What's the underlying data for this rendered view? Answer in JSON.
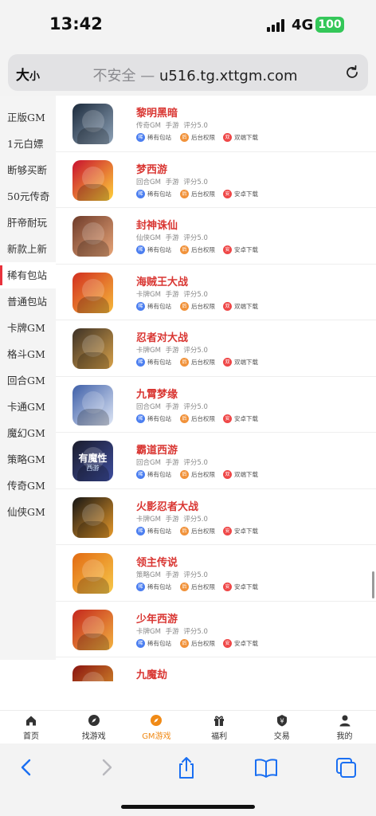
{
  "status_bar": {
    "time": "13:42",
    "network": "4G",
    "battery": "100"
  },
  "url_bar": {
    "text_size_label": "大",
    "text_size_small": "小",
    "insecure": "不安全 —",
    "domain": "u516.tg.xttgm.com"
  },
  "sidebar": {
    "items": [
      {
        "label": "正版GM",
        "active": false
      },
      {
        "label": "1元白嫖",
        "active": false
      },
      {
        "label": "断够买断",
        "active": false
      },
      {
        "label": "50元传奇",
        "active": false
      },
      {
        "label": "肝帝耐玩",
        "active": false
      },
      {
        "label": "新款上新",
        "active": false
      },
      {
        "label": "稀有包站",
        "active": true
      },
      {
        "label": "普通包站",
        "active": false
      },
      {
        "label": "卡牌GM",
        "active": false
      },
      {
        "label": "格斗GM",
        "active": false
      },
      {
        "label": "回合GM",
        "active": false
      },
      {
        "label": "卡通GM",
        "active": false
      },
      {
        "label": "魔幻GM",
        "active": false
      },
      {
        "label": "策略GM",
        "active": false
      },
      {
        "label": "传奇GM",
        "active": false
      },
      {
        "label": "仙侠GM",
        "active": false
      }
    ]
  },
  "games": [
    {
      "name": "黎明黑暗",
      "genre": "传奇GM",
      "platform": "手游",
      "rating": "评分5.0",
      "tag1": "稀有包站",
      "tag1_icon": "稀",
      "tag2": "后台权限",
      "tag2_icon": "后",
      "tag3": "双端下载",
      "tag3_icon": "双",
      "colors": [
        "#1b2a3c",
        "#8fa3b8"
      ]
    },
    {
      "name": "梦西游",
      "genre": "回合GM",
      "platform": "手游",
      "rating": "评分5.0",
      "tag1": "稀有包站",
      "tag1_icon": "稀",
      "tag2": "后台权限",
      "tag2_icon": "后",
      "tag3": "安卓下载",
      "tag3_icon": "安",
      "colors": [
        "#c8102e",
        "#ffd23a"
      ]
    },
    {
      "name": "封神诛仙",
      "genre": "仙侠GM",
      "platform": "手游",
      "rating": "评分5.0",
      "tag1": "稀有包站",
      "tag1_icon": "稀",
      "tag2": "后台权限",
      "tag2_icon": "后",
      "tag3": "安卓下载",
      "tag3_icon": "安",
      "colors": [
        "#6e3b2a",
        "#e8a578"
      ]
    },
    {
      "name": "海贼王大战",
      "genre": "卡牌GM",
      "platform": "手游",
      "rating": "评分5.0",
      "tag1": "稀有包站",
      "tag1_icon": "稀",
      "tag2": "后台权限",
      "tag2_icon": "后",
      "tag3": "双端下载",
      "tag3_icon": "双",
      "colors": [
        "#d22f1f",
        "#f6b93a"
      ]
    },
    {
      "name": "忍者对大战",
      "genre": "卡牌GM",
      "platform": "手游",
      "rating": "评分5.0",
      "tag1": "稀有包站",
      "tag1_icon": "稀",
      "tag2": "后台权限",
      "tag2_icon": "后",
      "tag3": "双端下载",
      "tag3_icon": "双",
      "colors": [
        "#3b3026",
        "#d8a24a"
      ]
    },
    {
      "name": "九霄梦缘",
      "genre": "回合GM",
      "platform": "手游",
      "rating": "评分5.0",
      "tag1": "稀有包站",
      "tag1_icon": "稀",
      "tag2": "后台权限",
      "tag2_icon": "后",
      "tag3": "安卓下载",
      "tag3_icon": "安",
      "colors": [
        "#3e5fa8",
        "#dfe7f6"
      ]
    },
    {
      "name": "霸道西游",
      "genre": "回合GM",
      "platform": "手游",
      "rating": "评分5.0",
      "tag1": "稀有包站",
      "tag1_icon": "稀",
      "tag2": "后台权限",
      "tag2_icon": "后",
      "tag3": "双端下载",
      "tag3_icon": "双",
      "colors": [
        "#1b1c2b",
        "#3d4d9e"
      ],
      "logo_text": "有魔性",
      "logo_sub": "西游"
    },
    {
      "name": "火影忍者大战",
      "genre": "卡牌GM",
      "platform": "手游",
      "rating": "评分5.0",
      "tag1": "稀有包站",
      "tag1_icon": "稀",
      "tag2": "后台权限",
      "tag2_icon": "后",
      "tag3": "安卓下载",
      "tag3_icon": "安",
      "colors": [
        "#141414",
        "#e89a2a"
      ]
    },
    {
      "name": "领主传说",
      "genre": "策略GM",
      "platform": "手游",
      "rating": "评分5.0",
      "tag1": "稀有包站",
      "tag1_icon": "稀",
      "tag2": "后台权限",
      "tag2_icon": "后",
      "tag3": "安卓下载",
      "tag3_icon": "安",
      "colors": [
        "#e26a12",
        "#f7c94a"
      ]
    },
    {
      "name": "少年西游",
      "genre": "卡牌GM",
      "platform": "手游",
      "rating": "评分5.0",
      "tag1": "稀有包站",
      "tag1_icon": "稀",
      "tag2": "后台权限",
      "tag2_icon": "后",
      "tag3": "安卓下载",
      "tag3_icon": "安",
      "colors": [
        "#c4261d",
        "#f3b340"
      ]
    },
    {
      "name": "九魔劫",
      "genre": "",
      "platform": "",
      "rating": "",
      "tag1": "",
      "tag1_icon": "",
      "tag2": "",
      "tag2_icon": "",
      "tag3": "",
      "tag3_icon": "",
      "colors": [
        "#8a1410",
        "#e0a030"
      ]
    }
  ],
  "tabbar": {
    "items": [
      {
        "label": "首页",
        "icon": "home-icon",
        "active": false
      },
      {
        "label": "找游戏",
        "icon": "compass-icon",
        "active": false
      },
      {
        "label": "GM游戏",
        "icon": "gm-compass-icon",
        "active": true
      },
      {
        "label": "福利",
        "icon": "gift-icon",
        "active": false
      },
      {
        "label": "交易",
        "icon": "trade-yen-icon",
        "active": false
      },
      {
        "label": "我的",
        "icon": "user-icon",
        "active": false
      }
    ]
  },
  "theme": {
    "accent": "#f08a16",
    "title_red": "#d93632",
    "side_active": "#e8323c",
    "toolbar_blue": "#1a6ff2"
  }
}
